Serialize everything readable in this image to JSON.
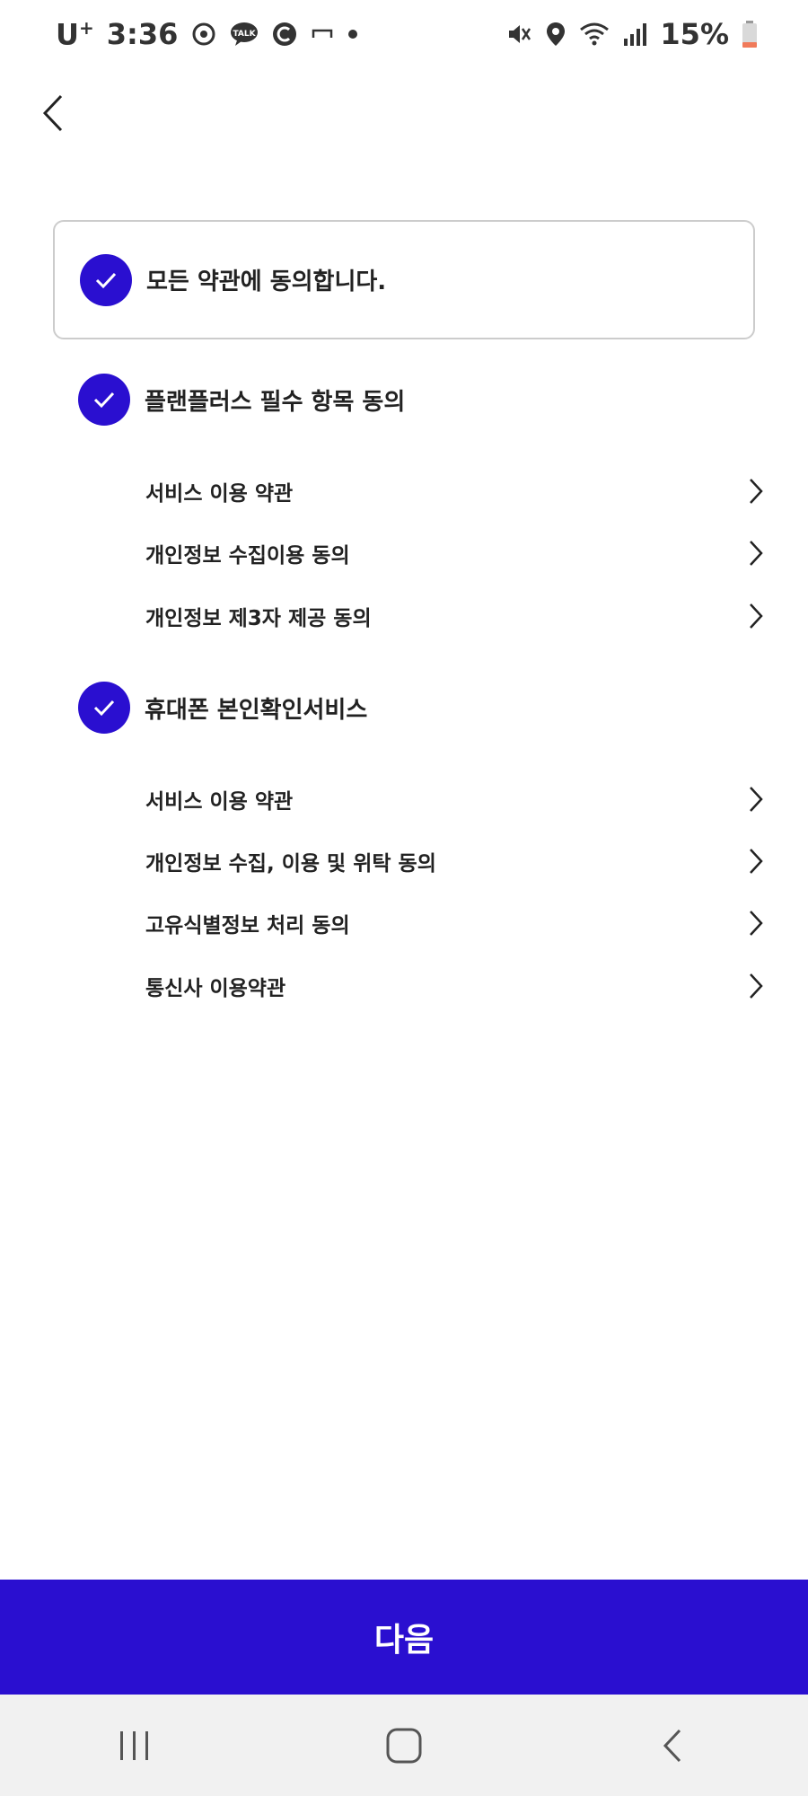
{
  "status_bar": {
    "carrier": "U",
    "carrier_sup": "+",
    "time": "3:36",
    "battery": "15%"
  },
  "agree_all": {
    "label": "모든 약관에 동의합니다.",
    "checked": true
  },
  "groups": [
    {
      "title": "플랜플러스 필수 항목 동의",
      "checked": true,
      "items": [
        "서비스 이용 약관",
        "개인정보 수집이용 동의",
        "개인정보 제3자 제공 동의"
      ]
    },
    {
      "title": "휴대폰 본인확인서비스",
      "checked": true,
      "items": [
        "서비스 이용 약관",
        "개인정보 수집, 이용 및 위탁 동의",
        "고유식별정보 처리 동의",
        "통신사 이용약관"
      ]
    }
  ],
  "next_button": {
    "label": "다음"
  },
  "colors": {
    "accent": "#2a0fd0",
    "border": "#cccccc",
    "navbar_bg": "#f1f1f1"
  }
}
